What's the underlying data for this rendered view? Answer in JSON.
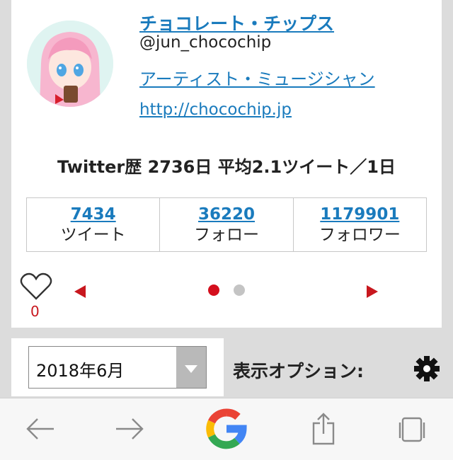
{
  "profile": {
    "name": "チョコレート・チップス",
    "handle": "@jun_chocochip",
    "role": "アーティスト・ミュージシャン",
    "url": "http://chocochip.jp"
  },
  "history": "Twitter歴 2736日 平均2.1ツイート／1日",
  "stats": [
    {
      "value": "7434",
      "label": "ツイート"
    },
    {
      "value": "36220",
      "label": "フォロー"
    },
    {
      "value": "1179901",
      "label": "フォロワー"
    }
  ],
  "likes": {
    "count": "0"
  },
  "pager": {
    "total": 2,
    "current": 1
  },
  "month_select": {
    "value": "2018年6月"
  },
  "options": {
    "label": "表示オプション:"
  },
  "icons": {
    "heart": "heart-icon",
    "gear": "gear-icon",
    "back": "back-arrow-icon",
    "forward": "forward-arrow-icon",
    "google": "google-logo-icon",
    "share": "share-icon",
    "tabs": "tabs-icon"
  },
  "colors": {
    "accent": "#c8171e",
    "link": "#1a7bbd"
  }
}
